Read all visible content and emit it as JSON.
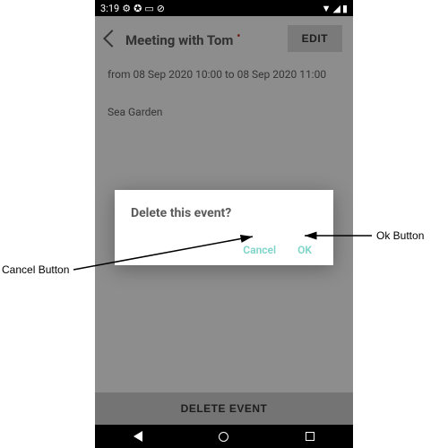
{
  "status": {
    "time": "3:19",
    "gear_icon": "⚙",
    "shield_icon": "✪",
    "card_icon": "▭",
    "noentry_icon": "⊘",
    "wifi_icon": "▼",
    "signal_icon": "◢",
    "battery_icon": "▮"
  },
  "header": {
    "title": "Meeting with Tom",
    "edit_label": "EDIT"
  },
  "detail": {
    "time_range": "from 08 Sep 2020 10:00 to 08 Sep 2020 11:00",
    "location": "Sea Garden"
  },
  "footer": {
    "delete_label": "DELETE EVENT"
  },
  "dialog": {
    "title": "Delete this event?",
    "cancel_label": "Cancel",
    "ok_label": "OK"
  },
  "annotations": {
    "cancel": "Cancel Button",
    "ok": "Ok Button"
  }
}
